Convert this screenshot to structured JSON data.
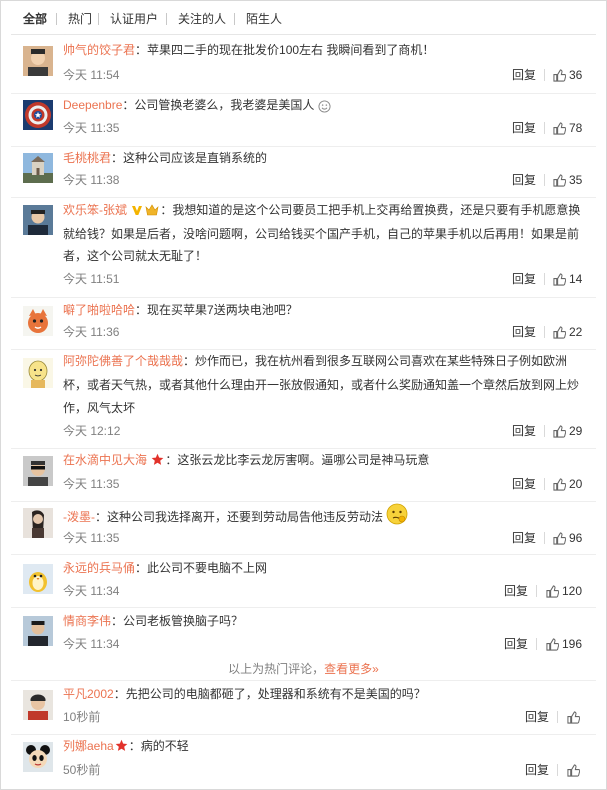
{
  "tabs": [
    "全部",
    "热门",
    "认证用户",
    "关注的人",
    "陌生人"
  ],
  "reply_label": "回复",
  "comments": [
    {
      "user": "帅气的饺子君",
      "text": "：苹果四二手的现在批发价100左右 我瞬间看到了商机！",
      "time": "今天 11:54",
      "likes": "36"
    },
    {
      "user": "Deepenbre",
      "text": "：公司管换老婆么，我老婆是美国人",
      "time": "今天 11:35",
      "likes": "78"
    },
    {
      "user": "毛桃桃君",
      "text": "：这种公司应该是直销系统的",
      "time": "今天 11:38",
      "likes": "35"
    },
    {
      "user": "欢乐笨-张斌",
      "text1": "：我想知道的是这个公司要员工把手机上交再给置换费，还是只要有手机愿意换",
      "text2": "就给钱？如果是后者，没啥问题啊，公司给钱买个国产手机，自己的苹果手机以后再用！如果是前",
      "text3": "者，这个公司就太无耻了！",
      "time": "今天 11:51",
      "likes": "14"
    },
    {
      "user": "噼了啪啦哈哈",
      "text": "：现在买苹果7送两块电池吧？",
      "time": "今天 11:36",
      "likes": "22"
    },
    {
      "user": "阿弥陀佛善了个哉哉哉",
      "text1": "：炒作而已，我在杭州看到很多互联网公司喜欢在某些特殊日子例如欧洲",
      "text2": "杯，或者天气热，或者其他什么理由开一张放假通知，或者什么奖励通知盖一个章然后放到网上炒",
      "text3": "作，风气太坏",
      "time": "今天 12:12",
      "likes": "29"
    },
    {
      "user": "在水滴中见大海",
      "text": "：这张云龙比李云龙厉害啊。逼哪公司是神马玩意",
      "time": "今天 11:35",
      "likes": "20"
    },
    {
      "user": "-泼墨-",
      "text": "：这种公司我选择离开，还要到劳动局告他违反劳动法",
      "time": "今天 11:35",
      "likes": "96"
    },
    {
      "user": "永远的兵马俑",
      "text": "：此公司不要电脑不上网",
      "time": "今天 11:34",
      "likes": "120"
    },
    {
      "user": "情商李伟",
      "text": "：公司老板管换脑子吗？",
      "time": "今天 11:34",
      "likes": "196"
    }
  ],
  "more": {
    "prefix": "以上为热门评论，",
    "link": "查看更多»"
  },
  "recent": [
    {
      "user": "平凡2002",
      "text": "：先把公司的电脑都砸了，处理器和系统有不是美国的吗？",
      "time": "10秒前"
    },
    {
      "user": "列娜aeha",
      "text": "：病的不轻",
      "time": "50秒前"
    }
  ]
}
